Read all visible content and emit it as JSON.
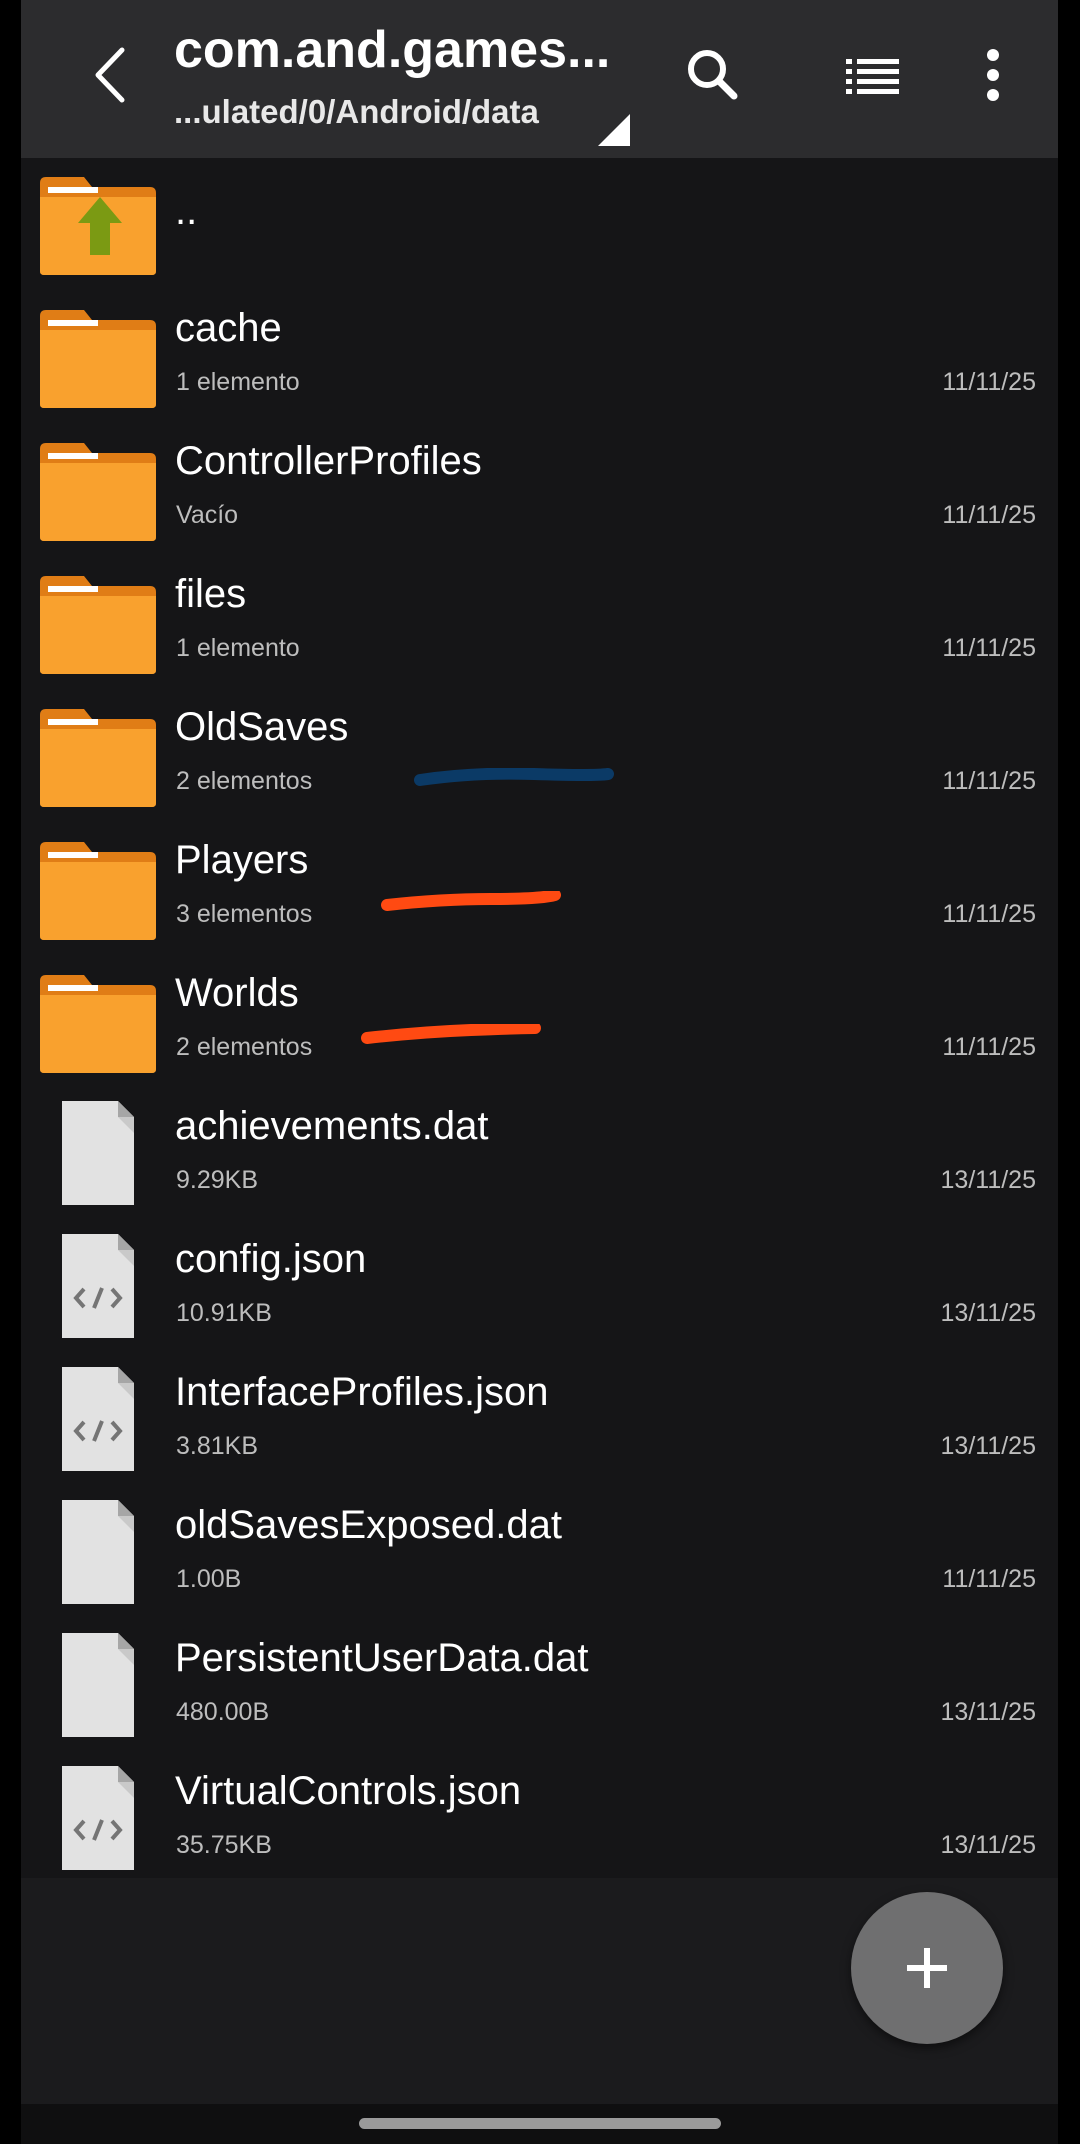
{
  "header": {
    "title": "com.and.games...",
    "path": "...ulated/0/Android/data",
    "icons": [
      "back-arrow-icon",
      "search-icon",
      "list-view-icon",
      "more-vert-icon",
      "dropdown-triangle-icon"
    ]
  },
  "items": [
    {
      "type": "parent",
      "name": "..",
      "meta": "",
      "date": "",
      "icon": "parent-folder-icon"
    },
    {
      "type": "folder",
      "name": "cache",
      "meta": "1 elemento",
      "date": "11/11/25",
      "icon": "folder-icon"
    },
    {
      "type": "folder",
      "name": "ControllerProfiles",
      "meta": "Vacío",
      "date": "11/11/25",
      "icon": "folder-icon"
    },
    {
      "type": "folder",
      "name": "files",
      "meta": "1 elemento",
      "date": "11/11/25",
      "icon": "folder-icon"
    },
    {
      "type": "folder",
      "name": "OldSaves",
      "meta": "2 elementos",
      "date": "11/11/25",
      "icon": "folder-icon"
    },
    {
      "type": "folder",
      "name": "Players",
      "meta": "3 elementos",
      "date": "11/11/25",
      "icon": "folder-icon"
    },
    {
      "type": "folder",
      "name": "Worlds",
      "meta": "2 elementos",
      "date": "11/11/25",
      "icon": "folder-icon"
    },
    {
      "type": "file",
      "name": "achievements.dat",
      "meta": "9.29KB",
      "date": "13/11/25",
      "icon": "file-icon"
    },
    {
      "type": "code",
      "name": "config.json",
      "meta": "10.91KB",
      "date": "13/11/25",
      "icon": "code-file-icon"
    },
    {
      "type": "code",
      "name": "InterfaceProfiles.json",
      "meta": "3.81KB",
      "date": "13/11/25",
      "icon": "code-file-icon"
    },
    {
      "type": "file",
      "name": "oldSavesExposed.dat",
      "meta": "1.00B",
      "date": "11/11/25",
      "icon": "file-icon"
    },
    {
      "type": "file",
      "name": "PersistentUserData.dat",
      "meta": "480.00B",
      "date": "13/11/25",
      "icon": "file-icon"
    },
    {
      "type": "code",
      "name": "VirtualControls.json",
      "meta": "35.75KB",
      "date": "13/11/25",
      "icon": "code-file-icon"
    }
  ],
  "annotations": [
    {
      "target": "OldSaves",
      "color": "#0b3a66"
    },
    {
      "target": "Players",
      "color": "#ff4a12"
    },
    {
      "target": "Worlds",
      "color": "#ff4a12"
    }
  ],
  "fab": {
    "icon": "plus-icon"
  },
  "colors": {
    "background": "#151517",
    "appbar": "#2c2c2e",
    "folder": "#f9a12e",
    "folder_tab": "#e07d16",
    "parent_arrow": "#7b9a13",
    "file": "#e2e2e2",
    "file_fold": "#a6a6a6"
  }
}
